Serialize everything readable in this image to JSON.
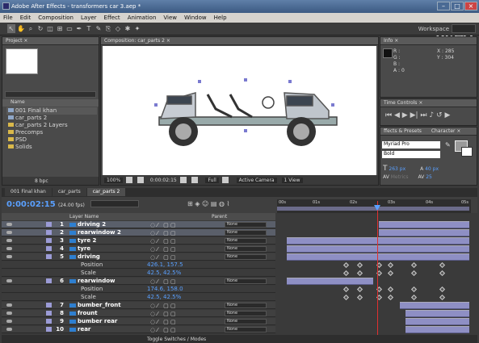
{
  "window": {
    "title": "Adobe After Effects - transformers car 3.aep *"
  },
  "watermark": "优酷",
  "menu": [
    "File",
    "Edit",
    "Composition",
    "Layer",
    "Effect",
    "Animation",
    "View",
    "Window",
    "Help"
  ],
  "workspace_label": "Workspace",
  "project": {
    "tab": "Project ×",
    "column_name": "Name",
    "items": [
      {
        "name": "001 Final khan",
        "type": "comp"
      },
      {
        "name": "car_parts 2",
        "type": "comp"
      },
      {
        "name": "car_parts 2 Layers",
        "type": "folder"
      },
      {
        "name": "Precomps",
        "type": "folder"
      },
      {
        "name": "PSD",
        "type": "folder"
      },
      {
        "name": "Solids",
        "type": "folder"
      }
    ],
    "bpc": "8 bpc"
  },
  "composition": {
    "tab": "Composition: car_parts 2 ×",
    "zoom": "100%",
    "timecode": "0:00:02:15",
    "resolution": "Full",
    "camera": "Active Camera",
    "view": "1 View"
  },
  "info": {
    "tab": "Info ×",
    "r": "R :",
    "g": "G :",
    "b": "B :",
    "a": "A : 0",
    "x": "X : 285",
    "y": "Y : 304"
  },
  "time_controls": {
    "tab": "Time Controls ×"
  },
  "effects_tab": "ffects & Presets",
  "character": {
    "tab": "Character ×",
    "font": "Myriad Pro",
    "style": "Bold",
    "size": "263 px",
    "leading": "40 px",
    "tracking": "25",
    "metrics": "Metrics"
  },
  "timeline": {
    "tabs": [
      "001 Final khan",
      "car_parts",
      "car_parts 2"
    ],
    "active_tab": 2,
    "timecode": "0:00:02:15",
    "fps": "(24.00 fps)",
    "col_layer": "Layer Name",
    "col_parent": "Parent",
    "ruler": [
      "00s",
      "01s",
      "02s",
      "03s",
      "04s",
      "05s"
    ],
    "toggle_label": "Toggle Switches / Modes",
    "layers": [
      {
        "num": "1",
        "name": "driving 2",
        "type": "layer",
        "parent": "None",
        "sel": true
      },
      {
        "num": "2",
        "name": "rearwindow 2",
        "type": "layer",
        "parent": "None",
        "sel": true
      },
      {
        "num": "3",
        "name": "tyre 2",
        "type": "layer",
        "parent": "None"
      },
      {
        "num": "4",
        "name": "tyre",
        "type": "layer",
        "parent": "None"
      },
      {
        "num": "5",
        "name": "driving",
        "type": "layer",
        "parent": "None"
      },
      {
        "name": "Position",
        "value": "426.1, 157.5",
        "type": "prop"
      },
      {
        "name": "Scale",
        "value": "42.5, 42.5%",
        "type": "prop"
      },
      {
        "num": "6",
        "name": "rearwindow",
        "type": "layer",
        "parent": "None"
      },
      {
        "name": "Position",
        "value": "174.6, 158.0",
        "type": "prop"
      },
      {
        "name": "Scale",
        "value": "42.5, 42.5%",
        "type": "prop"
      },
      {
        "num": "7",
        "name": "bumber_front",
        "type": "layer",
        "parent": "None"
      },
      {
        "num": "8",
        "name": "frount",
        "type": "layer",
        "parent": "None"
      },
      {
        "num": "9",
        "name": "bumber rear",
        "type": "layer",
        "parent": "None"
      },
      {
        "num": "10",
        "name": "rear",
        "type": "layer",
        "parent": "None"
      }
    ]
  }
}
